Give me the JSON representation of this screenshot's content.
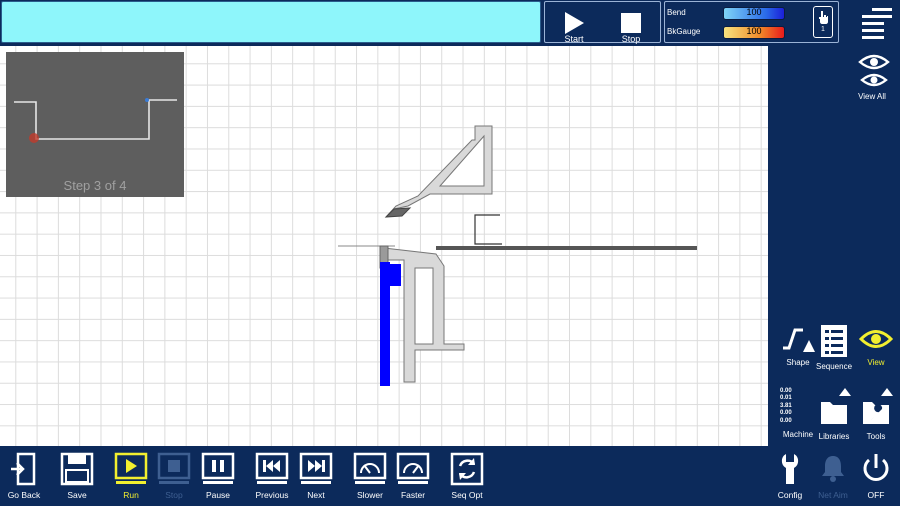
{
  "topbar": {
    "start_label": "Start",
    "stop_label": "Stop",
    "bend_label": "Bend",
    "bend_value": "100",
    "bkgauge_label": "BkGauge",
    "bkgauge_value": "100",
    "hand_count": "1"
  },
  "preview": {
    "step_text": "Step 3 of 4"
  },
  "sidebar": {
    "view_all_label": "View All",
    "shape_label": "Shape",
    "sequence_label": "Sequence",
    "view_label": "View",
    "machine_label": "Machine",
    "machine_readout": [
      "0.00",
      "0.01",
      "3.81",
      "0.00",
      "0.00"
    ],
    "libraries_label": "Libraries",
    "tools_label": "Tools",
    "config_label": "Config",
    "net_aim_label": "Net Aim",
    "off_label": "OFF"
  },
  "toolbar": {
    "go_back_label": "Go Back",
    "save_label": "Save",
    "run_label": "Run",
    "stop_label": "Stop",
    "pause_label": "Pause",
    "previous_label": "Previous",
    "next_label": "Next",
    "slower_label": "Slower",
    "faster_label": "Faster",
    "seq_opt_label": "Seq Opt"
  },
  "colors": {
    "panel_bg": "#0c2a5b",
    "title_field": "#8ef6fb",
    "active_highlight": "#f2ef2f",
    "tool_blue": "#0000ff"
  }
}
